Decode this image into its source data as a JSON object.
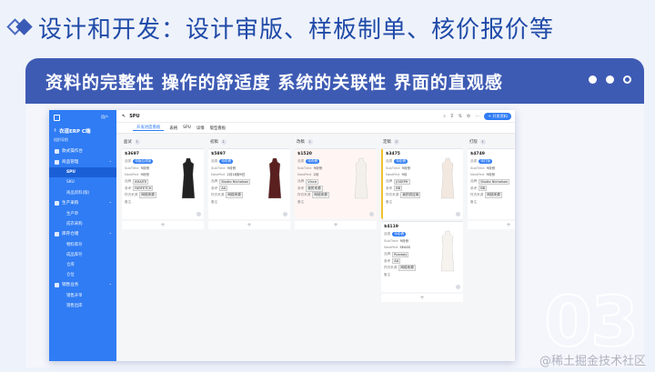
{
  "slide": {
    "title": "设计和开发：设计审版、样板制单、核价报价等",
    "banner": "资料的完整性  操作的舒适度  系统的关联性  界面的直观感",
    "number": "03",
    "watermark": "@稀土掘金技术社区"
  },
  "app": {
    "page_title": "SPU",
    "add_button": "+ 开发资料",
    "sidebar": {
      "user": "用户",
      "brand": "衣道ERP C端",
      "sub": "组织导航",
      "items": [
        {
          "label": "款式操作台",
          "children": []
        },
        {
          "label": "商品管理",
          "children": [
            "SPU",
            "SKU",
            "商品资料(版)"
          ]
        },
        {
          "label": "生产采购",
          "children": [
            "生产单",
            "成衣采购"
          ]
        },
        {
          "label": "库存仓储",
          "children": [
            "物料库存",
            "成品库存",
            "仓库",
            "仓位"
          ]
        },
        {
          "label": "销售业务",
          "children": [
            "销售开单",
            "销售出库"
          ]
        }
      ]
    },
    "tabs": [
      "开发进度看板",
      "表格",
      "SPU",
      "详情",
      "版型看板"
    ],
    "columns": [
      {
        "name": "面试",
        "count": "1",
        "cards": [
          {
            "code": "$3697",
            "status": "待版后改版",
            "subtime": "9月份",
            "nextpart": "9月份",
            "brand": "KHAITE",
            "source": "FARFETCH",
            "owner": "网络来源"
          }
        ]
      },
      {
        "name": "初稿",
        "count": "1",
        "cards": [
          {
            "code": "$5897",
            "status": "待初稿",
            "subtime": "9月份",
            "nextpart": "2月18到9日",
            "brand": "Studio Nicholson",
            "source": "AA",
            "owner": "网络来源"
          }
        ]
      },
      {
        "name": "改稿",
        "count": "1",
        "cards": [
          {
            "code": "$1520",
            "status": "待改稿",
            "subtime": "9月份",
            "nextpart": "2月",
            "brand": "Vince",
            "source": "我的来源",
            "owner": "网络来源"
          }
        ]
      },
      {
        "name": "定稿",
        "count": "2",
        "cards": [
          {
            "code": "$3475",
            "status": "待定稿",
            "subtime": "9月份",
            "nextpart": "9月",
            "brand": "JOSEPH",
            "source": "BB",
            "owner": "我的供应商"
          },
          {
            "code": "$4119",
            "status": "待定稿",
            "subtime": "9月份",
            "nextpart": "SEASS",
            "brand": "Runway",
            "source": "AA",
            "owner": "网络来源"
          }
        ]
      },
      {
        "name": "打版",
        "count": "1",
        "cards": [
          {
            "code": "$4749",
            "status": "待打版",
            "subtime": "9月份",
            "nextpart": "9月份",
            "brand": "Studio Nicholson",
            "source": "BB",
            "owner": "网络来源"
          }
        ]
      }
    ],
    "field_labels": {
      "status": "品类",
      "subtime": "SubTime",
      "nextpart": "NextPart",
      "brand": "品牌",
      "source": "参考",
      "owner": "样衣来源",
      "comment": "备注"
    },
    "colors": {
      "sidebar": "#2f7cf4",
      "banner": "#3e5bb4",
      "title": "#1f4aa8"
    }
  }
}
